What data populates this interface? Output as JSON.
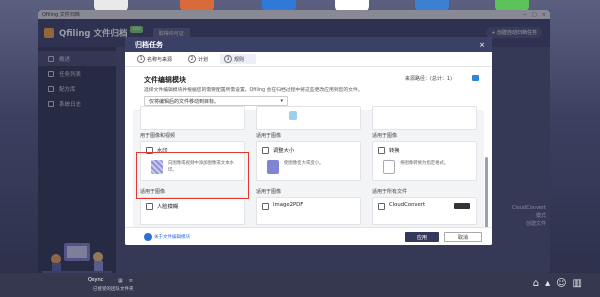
{
  "app": {
    "window_title": "Qfiling 文件归档",
    "title": "Qfiling 文件归档",
    "edition_badge": "Lite",
    "license_button": "取得许可证",
    "create_button": "+ 创建自动归档任务",
    "window_controls": [
      "−",
      "□",
      "×"
    ]
  },
  "sidebar": {
    "items": [
      {
        "label": "概述",
        "icon": "overview-icon",
        "active": true
      },
      {
        "label": "任务列表",
        "icon": "task-list-icon",
        "active": false
      },
      {
        "label": "配方库",
        "icon": "recipe-icon",
        "active": false
      },
      {
        "label": "系统日志",
        "icon": "log-icon",
        "active": false
      }
    ]
  },
  "background_text": {
    "cloudconvert": "CloudConvert",
    "mode": "模式",
    "created": "创建文件"
  },
  "modal": {
    "title": "归档任务",
    "close": "×",
    "steps": [
      {
        "num": "1",
        "label": "名称与来源"
      },
      {
        "num": "2",
        "label": "计划"
      },
      {
        "num": "3",
        "label": "规则"
      }
    ],
    "section_title": "文件编辑模块",
    "section_desc": "选择文件编辑模块并根据您的需要配置所需设置。Qfiling 会在归档过程中将这些更改应用到您的文件。",
    "source_path": "来源路径：(总计：1)",
    "select_value": "仅将编辑后的文件移动到目标。",
    "group_images_video": "用于图像和视频",
    "group_images_1": "适用于图像",
    "group_images_2": "适用于图像",
    "group_images_3": "适用于图像",
    "group_images_4": "适用于图像",
    "group_all_files": "适用于所有文件",
    "cards": {
      "watermark": {
        "name": "水印",
        "desc": "向图像或视频中添加图像或文本水印。"
      },
      "resize": {
        "name": "调整大小",
        "desc": "使图像变大或变小。"
      },
      "convert": {
        "name": "转换",
        "desc": "将图像转换为指定格式。"
      },
      "face_blur": {
        "name": "人脸模糊",
        "desc": ""
      },
      "image2pdf": {
        "name": "Image2PDF",
        "desc": ""
      },
      "cloudconvert": {
        "name": "CloudConvert",
        "desc": ""
      }
    },
    "learn_more": "关于文件编辑模块",
    "apply_button": "应用",
    "cancel_button": "取消"
  },
  "taskbar": {
    "app_name": "Qsync",
    "status": "已接受的团队文件夹"
  },
  "colors": {
    "header_bg": "#3b4066",
    "highlight_border": "#e03a2f",
    "apply_bg": "#34385a",
    "link": "#2f6ed8"
  }
}
